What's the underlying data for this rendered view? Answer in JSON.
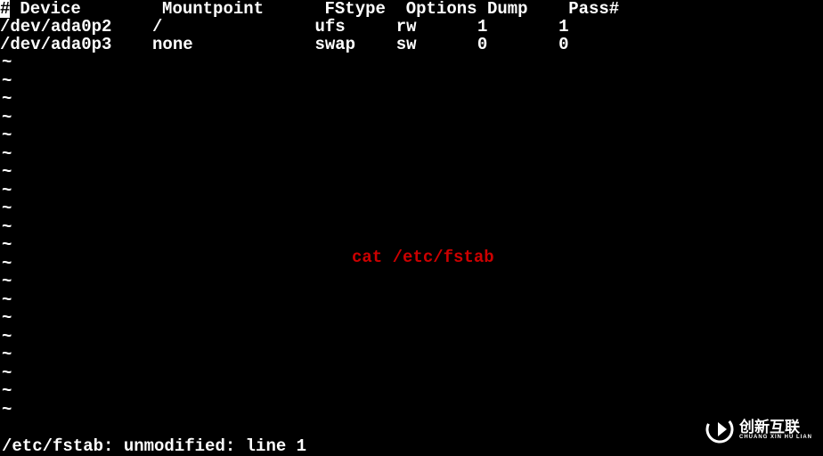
{
  "header": {
    "hash": "#",
    "device": " Device",
    "mountpoint": "Mountpoint",
    "fstype": "FStype",
    "options": "Options",
    "dump": "Dump",
    "pass": "Pass#"
  },
  "rows": [
    {
      "device": "/dev/ada0p2",
      "mountpoint": "/",
      "fstype": "ufs",
      "options": "rw",
      "dump": "1",
      "pass": "1"
    },
    {
      "device": "/dev/ada0p3",
      "mountpoint": "none",
      "fstype": "swap",
      "options": "sw",
      "dump": "0",
      "pass": "0"
    }
  ],
  "tilde": "~",
  "annotation": "cat /etc/fstab",
  "status": "/etc/fstab: unmodified: line 1",
  "logo": {
    "main": "创新互联",
    "sub": "CHUANG XIN HU LIAN"
  }
}
